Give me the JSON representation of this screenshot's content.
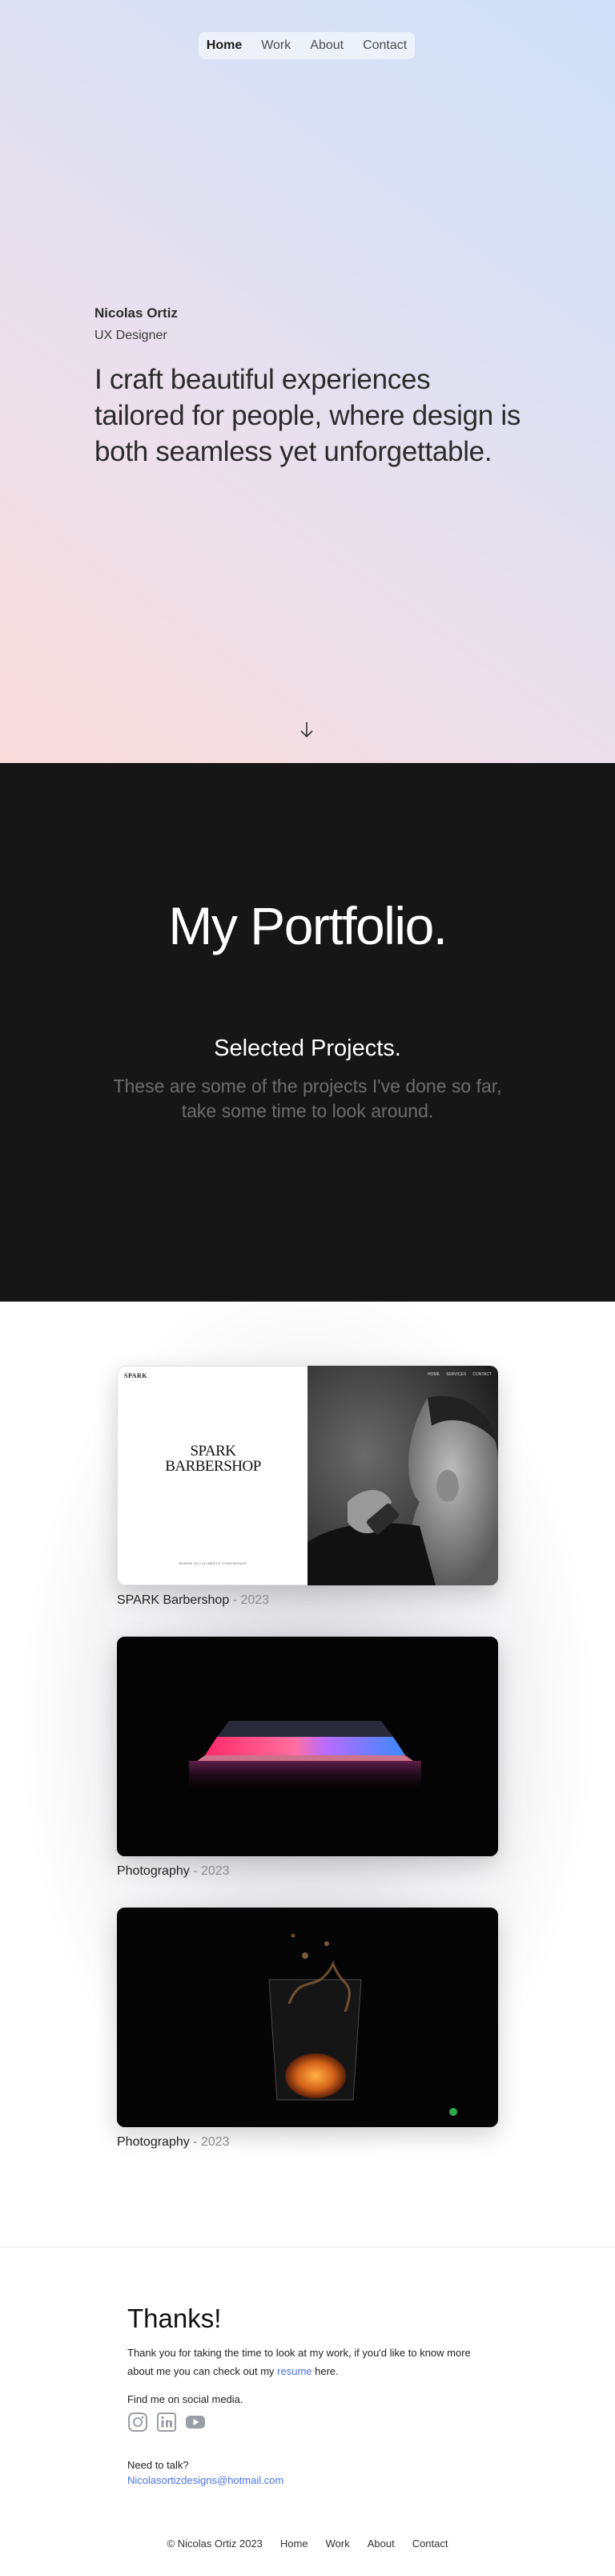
{
  "nav": {
    "items": [
      "Home",
      "Work",
      "About",
      "Contact"
    ]
  },
  "hero": {
    "name": "Nicolas Ortiz",
    "role": "UX Designer",
    "tagline": "I craft beautiful experiences tailored for people, where design is both seamless yet unforgettable."
  },
  "portfolio": {
    "title": "My Portfolio.",
    "subtitle": "Selected Projects.",
    "description": "These are some of the projects I've done so far, take some time to look around."
  },
  "projects": [
    {
      "name": "SPARK Barbershop",
      "year": "2023",
      "preview": {
        "logo": "SPARK",
        "heading_line1": "SPARK",
        "heading_line2": "BARBERSHOP",
        "small_text": "WHERE STYLE MEETS CONFIDENCE",
        "menu": [
          "HOME",
          "SERVICES",
          "CONTACT"
        ]
      }
    },
    {
      "name": "Photography",
      "year": "2023"
    },
    {
      "name": "Photography",
      "year": "2023"
    }
  ],
  "thanks": {
    "title": "Thanks!",
    "body_prefix": "Thank you for taking the time to look at my work, if you'd like to know more about me you can check out my ",
    "resume_link": "resume",
    "body_suffix": " here.",
    "social_label": "Find me on social media.",
    "social_icons": [
      "instagram-icon",
      "linkedin-icon",
      "youtube-icon"
    ],
    "talk_label": "Need to talk?",
    "email": "Nicolasortizdesigns@hotmail.com"
  },
  "footer": {
    "copyright": "© Nicolas Ortiz 2023",
    "links": [
      "Home",
      "Work",
      "About",
      "Contact"
    ]
  },
  "colors": {
    "accent_link": "#4a72e8",
    "dark_bg": "#161616"
  }
}
